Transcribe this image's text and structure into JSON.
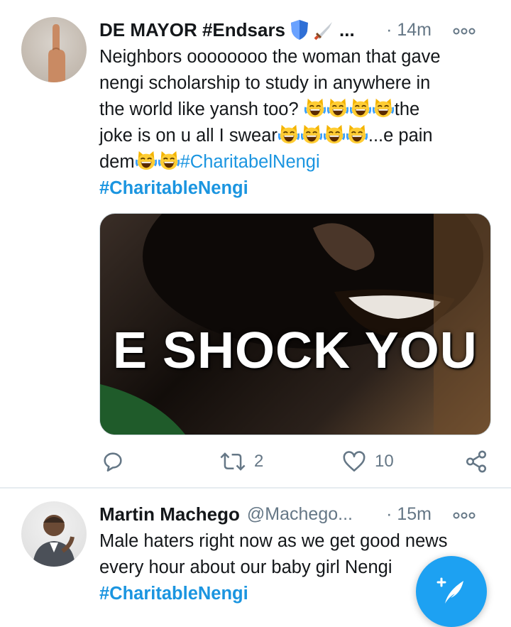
{
  "tweets": [
    {
      "author_name": "DE MAYOR #Endsars",
      "author_suffix": "...",
      "time": "· 14m",
      "lines": [
        "Neighbors oooooooo the woman that gave",
        "nengi scholarship to study in anywhere in",
        "the world like yansh too?",
        "the",
        "joke is on u all I swear",
        "...e pain",
        "dem"
      ],
      "inline_hashtag": "#CharitabelNengi",
      "hashtag": "#CharitableNengi",
      "media_caption": "E SHOCK YOU",
      "retweets": "2",
      "likes": "10"
    },
    {
      "author_name": "Martin Machego",
      "handle": "@Machego...",
      "time": "· 15m",
      "lines": [
        "Male haters right now as we get good news",
        "every hour about our baby girl Nengi"
      ],
      "hashtag": "#CharitableNengi"
    }
  ],
  "icons": {
    "more": "more-dots-icon",
    "reply": "reply-icon",
    "retweet": "retweet-icon",
    "like": "heart-icon",
    "share": "share-icon",
    "compose": "compose-tweet-icon",
    "emoji": "laughing-cat-emoji"
  },
  "colors": {
    "accent": "#1da1f2",
    "hashtag": "#1b95e0",
    "secondary_text": "#657786",
    "divider": "#e6ecf0"
  }
}
